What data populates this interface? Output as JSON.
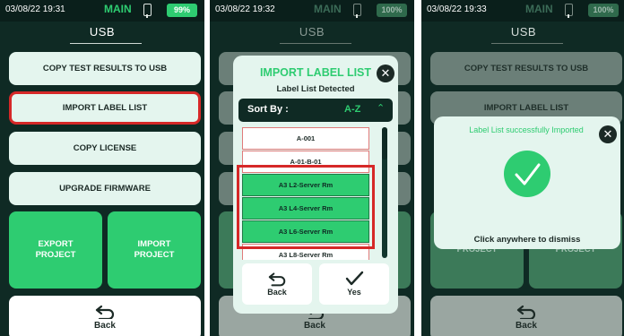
{
  "colors": {
    "panel_bg": "#0f2a24",
    "accent_green": "#2ecc71",
    "button_bg": "#e4f5ee",
    "highlight_red": "#d62828"
  },
  "panel1": {
    "status": {
      "time": "03/08/22 19:31",
      "mode": "MAIN",
      "battery": "99%",
      "icon": "plug-icon"
    },
    "title": "USB",
    "buttons": [
      "COPY TEST RESULTS TO USB",
      "IMPORT LABEL LIST",
      "COPY LICENSE",
      "UPGRADE FIRMWARE"
    ],
    "highlighted_button": "IMPORT LABEL LIST",
    "big_buttons": [
      "EXPORT PROJECT",
      "IMPORT PROJECT"
    ],
    "back_label": "Back"
  },
  "panel2": {
    "status": {
      "time": "03/08/22 19:32",
      "mode": "MAIN",
      "battery": "100%",
      "icon": "plug-icon"
    },
    "title": "USB",
    "back_label": "Back",
    "modal": {
      "title": "IMPORT LABEL LIST",
      "subtitle": "Label List Detected",
      "sort_label": "Sort By :",
      "sort_value": "A-Z",
      "items": [
        {
          "label": "A-001",
          "selected": false
        },
        {
          "label": "A-01-B-01",
          "selected": false
        },
        {
          "label": "A3 L2-Server Rm",
          "selected": true
        },
        {
          "label": "A3 L4-Server Rm",
          "selected": true
        },
        {
          "label": "A3 L6-Server Rm",
          "selected": true
        },
        {
          "label": "A3 L8-Server Rm",
          "selected": false
        }
      ],
      "back_label": "Back",
      "yes_label": "Yes"
    }
  },
  "panel3": {
    "status": {
      "time": "03/08/22 19:33",
      "mode": "MAIN",
      "battery": "100%",
      "icon": "plug-icon"
    },
    "title": "USB",
    "buttons": [
      "COPY TEST RESULTS TO USB",
      "IMPORT LABEL LIST"
    ],
    "big_buttons": [
      "PROJECT",
      "PROJECT"
    ],
    "back_label": "Back",
    "dialog": {
      "message": "Label List successfully Imported",
      "dismiss": "Click anywhere to dismiss"
    }
  }
}
